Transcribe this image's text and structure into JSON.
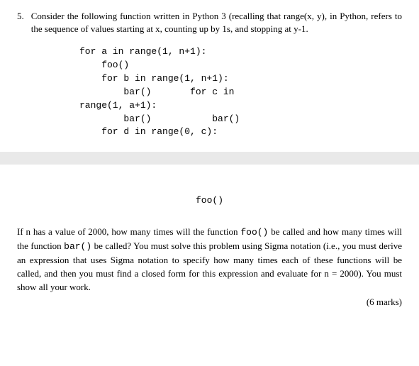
{
  "question": {
    "number": "5.",
    "intro": "Consider the following function written in Python 3 (recalling that range(x, y), in Python, refers to the sequence of values starting at x, counting up by 1s, and stopping at y-1."
  },
  "code": {
    "l1": "for a in range(1, n+1):",
    "l2": "    foo()",
    "l3": "    for b in range(1, n+1):",
    "l4": "        bar()       for c in",
    "l5": "range(1, a+1):",
    "l6": "        bar()           bar()",
    "l7": "    for d in range(0, c):"
  },
  "midline": "foo()",
  "prompt": {
    "p1": "If n has a value of 2000, how many times will the function ",
    "p1_code": "foo()",
    "p2": " be called and how many times will the function ",
    "p2_code": "bar()",
    "p3": " be called? You must solve this problem using Sigma notation (i.e., you must derive an expression that uses Sigma notation to specify how many times each of these functions will be called, and then you must find a closed form for this expression and evaluate for n = 2000). You must show all your work."
  },
  "marks": "(6 marks)"
}
